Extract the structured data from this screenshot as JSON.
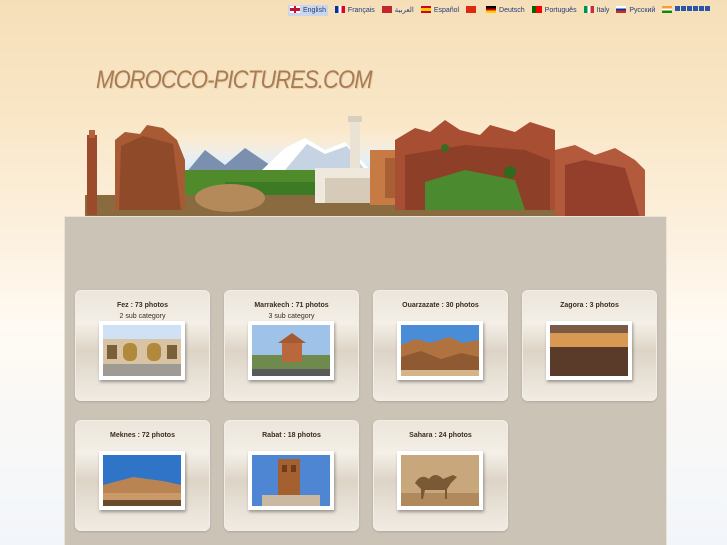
{
  "languages": [
    {
      "label": "English",
      "flag": "uk",
      "active": true
    },
    {
      "label": "Français",
      "flag": "fr"
    },
    {
      "label": "العربية",
      "flag": "ma"
    },
    {
      "label": "Español",
      "flag": "es"
    },
    {
      "label": "",
      "flag": "cn"
    },
    {
      "label": "Deutsch",
      "flag": "de"
    },
    {
      "label": "Português",
      "flag": "pt"
    },
    {
      "label": "Italy",
      "flag": "it"
    },
    {
      "label": "Русский",
      "flag": "ru"
    },
    {
      "label": "",
      "flag": "in"
    }
  ],
  "site": {
    "logo": "MOROCCO-PICTURES.COM"
  },
  "categories": [
    {
      "title": "Fez : 73 photos",
      "sub": "2 sub category",
      "thumb": "royal-palace-gate-icon"
    },
    {
      "title": "Marrakech : 71 photos",
      "sub": "3 sub category",
      "thumb": "koutoubia-mosque-icon"
    },
    {
      "title": "Ouarzazate : 30 photos",
      "sub": "",
      "thumb": "desert-canyon-icon"
    },
    {
      "title": "Zagora : 3 photos",
      "sub": "",
      "thumb": "desert-sunset-icon"
    },
    {
      "title": "Meknes : 72 photos",
      "sub": "",
      "thumb": "city-wall-icon"
    },
    {
      "title": "Rabat : 18 photos",
      "sub": "",
      "thumb": "hassan-tower-icon"
    },
    {
      "title": "Sahara : 24 photos",
      "sub": "",
      "thumb": "camel-icon"
    }
  ]
}
